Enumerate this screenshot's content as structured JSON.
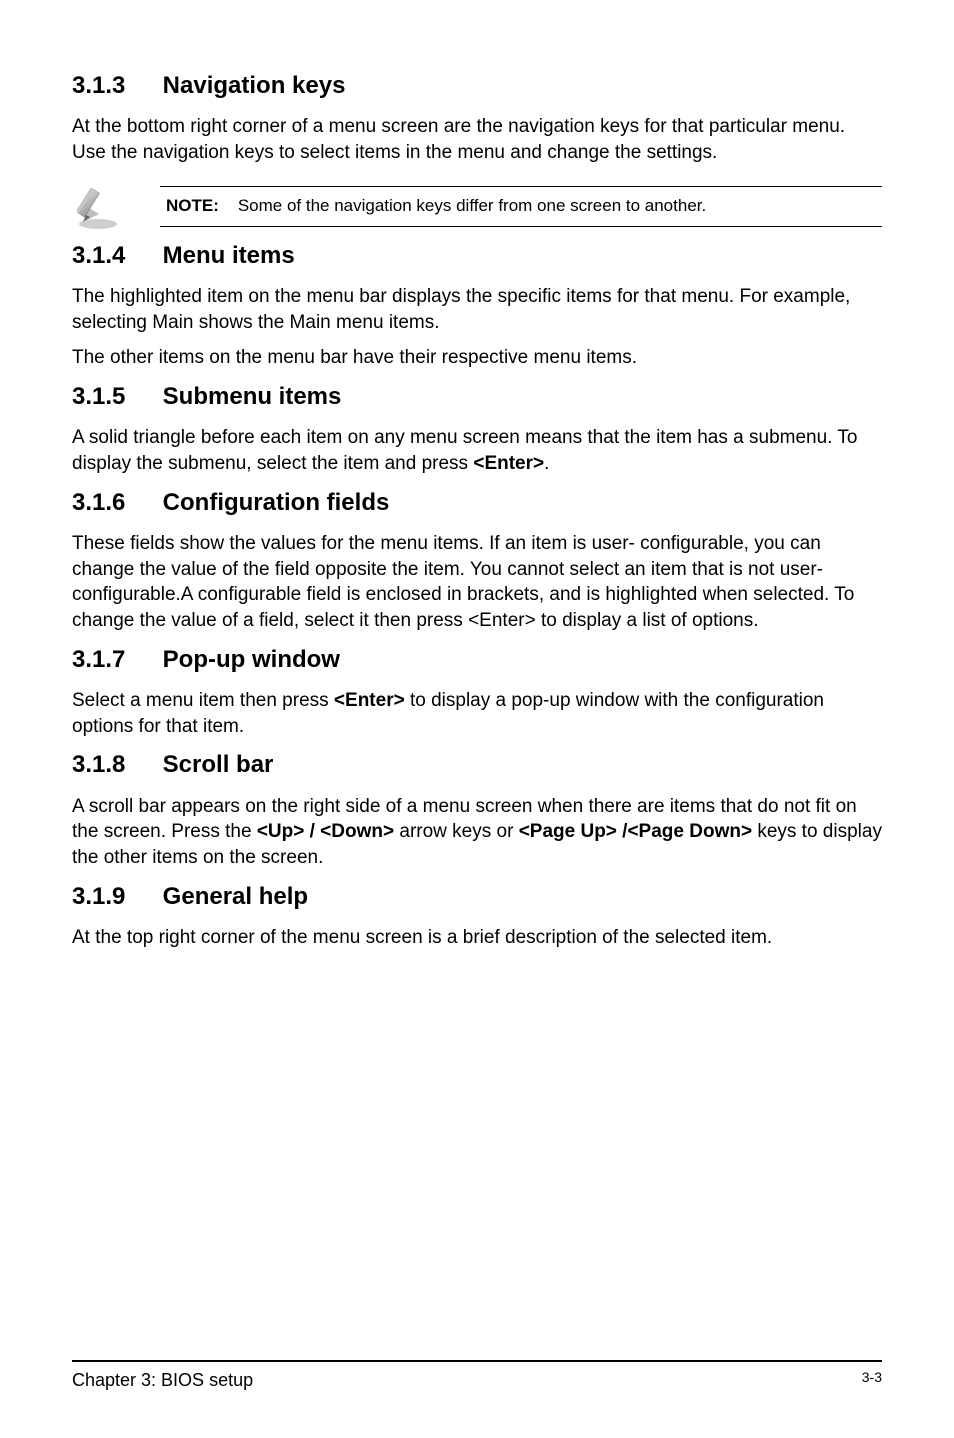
{
  "sections": {
    "s313": {
      "num": "3.1.3",
      "title": "Navigation keys",
      "p1": "At the bottom right corner of a menu screen are the navigation keys for that particular menu. Use the navigation keys to select items in the menu and change the settings."
    },
    "note": {
      "label": "NOTE:",
      "text": "Some of the navigation keys differ from one screen to another."
    },
    "s314": {
      "num": "3.1.4",
      "title": "Menu items",
      "p1": "The highlighted item on the menu bar displays the specific items for that menu. For example, selecting Main shows the Main menu items.",
      "p2": "The other items on the menu bar have their respective menu items."
    },
    "s315": {
      "num": "3.1.5",
      "title": "Submenu items",
      "p1_pre": "A solid triangle before each item on any menu screen means that the item has a submenu. To display the submenu, select the item and press ",
      "p1_key": "<Enter>",
      "p1_post": "."
    },
    "s316": {
      "num": "3.1.6",
      "title": "Configuration fields",
      "p1": "These fields show the values for the menu items. If an item is user- configurable, you can change the value of the field opposite the item. You cannot select an item that is not user-configurable.A configurable field is enclosed in brackets, and is highlighted when selected. To change the value of a field, select it then press <Enter> to display a list of options."
    },
    "s317": {
      "num": "3.1.7",
      "title": "Pop-up window",
      "p1_pre": "Select a menu item then press ",
      "p1_key": "<Enter>",
      "p1_post": " to display a pop-up window with the configuration options for that item."
    },
    "s318": {
      "num": "3.1.8",
      "title": "Scroll bar",
      "p1_a": "A scroll bar appears on the right side of a menu screen when there are items that do not fit on the screen. Press the ",
      "p1_key1": "<Up> / <Down>",
      "p1_b": " arrow keys or ",
      "p1_key2": "<Page Up> /<Page Down>",
      "p1_c": " keys to display the other items on the screen."
    },
    "s319": {
      "num": "3.1.9",
      "title": "General help",
      "p1": "At the top right corner of the menu screen is a brief description of the selected item."
    }
  },
  "footer": {
    "chapter": "Chapter 3: BIOS setup",
    "page": "3-3"
  }
}
